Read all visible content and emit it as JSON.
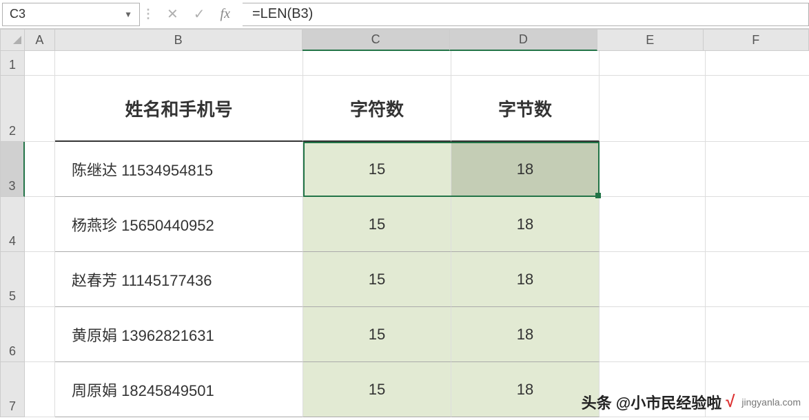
{
  "formula_bar": {
    "cell_ref": "C3",
    "formula": "=LEN(B3)",
    "fx_label": "fx"
  },
  "columns": {
    "a": "A",
    "b": "B",
    "c": "C",
    "d": "D",
    "e": "E",
    "f": "F"
  },
  "rows": {
    "r1": "1",
    "r2": "2",
    "r3": "3",
    "r4": "4",
    "r5": "5",
    "r6": "6",
    "r7": "7"
  },
  "headers": {
    "b": "姓名和手机号",
    "c": "字符数",
    "d": "字节数"
  },
  "data": [
    {
      "b": "陈继达 11534954815",
      "c": "15",
      "d": "18"
    },
    {
      "b": "杨燕珍 15650440952",
      "c": "15",
      "d": "18"
    },
    {
      "b": "赵春芳 11145177436",
      "c": "15",
      "d": "18"
    },
    {
      "b": "黄原娟 13962821631",
      "c": "15",
      "d": "18"
    },
    {
      "b": "周原娟 18245849501",
      "c": "15",
      "d": "18"
    }
  ],
  "watermark": {
    "text": "头条 @小市民经验啦",
    "site": "jingyanla.com"
  }
}
